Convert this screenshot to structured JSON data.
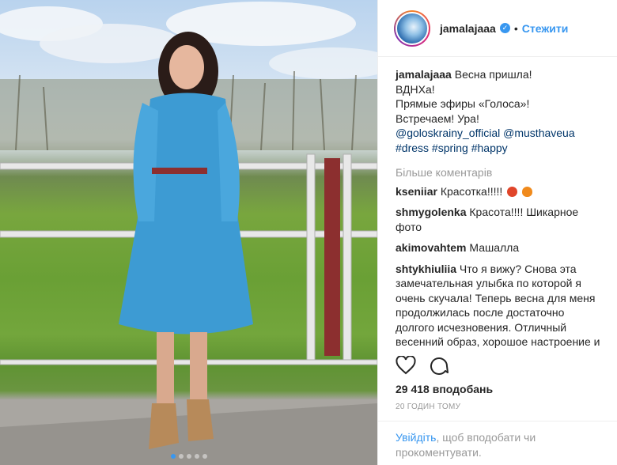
{
  "post": {
    "username": "jamalajaaa",
    "verified_icon": "verified-badge-icon",
    "separator": "•",
    "follow_label": "Стежити",
    "caption": {
      "username": "jamalajaaa",
      "lines": [
        "Весна пришла!",
        "ВДНХа!",
        "Прямые эфиры «Голоса»!",
        "Встречаем! Ура!"
      ],
      "mentions": [
        "@goloskrainy_official",
        "@musthaveua"
      ],
      "hashtags": [
        "#dress",
        "#spring",
        "#happy"
      ]
    },
    "more_comments_label": "Більше коментарів",
    "comments": [
      {
        "user": "kseniiar",
        "text": "Красотка!!!!!"
      },
      {
        "user": "shmygolenka",
        "text": "Красота!!!! Шикарное фото"
      },
      {
        "user": "akimovahtem",
        "text": "Машалла"
      },
      {
        "user": "shtykhiuliia",
        "text": "Что я вижу? Снова эта замечательная улыбка по которой я очень скучала! Теперь весна для меня продолжилась после достаточно долгого исчезновения. Отличный весенний образ, хорошое настроение и невероятная улыбка! Люблю!!!"
      }
    ],
    "likes_label": "29 418 вподобань",
    "time_label": "20 годин тому",
    "login_link": "Увійдіть",
    "login_rest": ", щоб вподобати чи прокоментувати."
  },
  "carousel": {
    "count": 5,
    "active_index": 0
  },
  "colors": {
    "accent": "#3897f0",
    "text": "#262626",
    "muted": "#999999"
  }
}
